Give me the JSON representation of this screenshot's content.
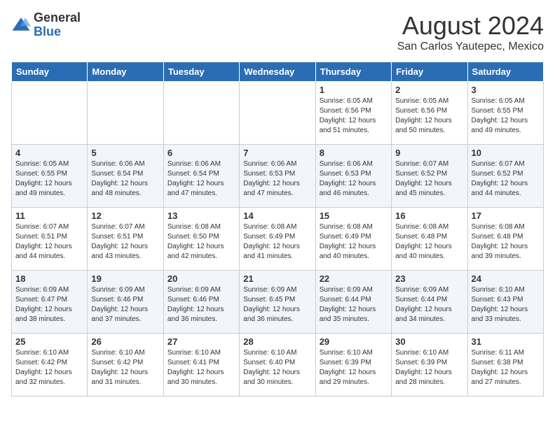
{
  "header": {
    "logo_general": "General",
    "logo_blue": "Blue",
    "month_title": "August 2024",
    "location": "San Carlos Yautepec, Mexico"
  },
  "weekdays": [
    "Sunday",
    "Monday",
    "Tuesday",
    "Wednesday",
    "Thursday",
    "Friday",
    "Saturday"
  ],
  "weeks": [
    [
      {
        "day": "",
        "info": ""
      },
      {
        "day": "",
        "info": ""
      },
      {
        "day": "",
        "info": ""
      },
      {
        "day": "",
        "info": ""
      },
      {
        "day": "1",
        "info": "Sunrise: 6:05 AM\nSunset: 6:56 PM\nDaylight: 12 hours\nand 51 minutes."
      },
      {
        "day": "2",
        "info": "Sunrise: 6:05 AM\nSunset: 6:56 PM\nDaylight: 12 hours\nand 50 minutes."
      },
      {
        "day": "3",
        "info": "Sunrise: 6:05 AM\nSunset: 6:55 PM\nDaylight: 12 hours\nand 49 minutes."
      }
    ],
    [
      {
        "day": "4",
        "info": "Sunrise: 6:05 AM\nSunset: 6:55 PM\nDaylight: 12 hours\nand 49 minutes."
      },
      {
        "day": "5",
        "info": "Sunrise: 6:06 AM\nSunset: 6:54 PM\nDaylight: 12 hours\nand 48 minutes."
      },
      {
        "day": "6",
        "info": "Sunrise: 6:06 AM\nSunset: 6:54 PM\nDaylight: 12 hours\nand 47 minutes."
      },
      {
        "day": "7",
        "info": "Sunrise: 6:06 AM\nSunset: 6:53 PM\nDaylight: 12 hours\nand 47 minutes."
      },
      {
        "day": "8",
        "info": "Sunrise: 6:06 AM\nSunset: 6:53 PM\nDaylight: 12 hours\nand 46 minutes."
      },
      {
        "day": "9",
        "info": "Sunrise: 6:07 AM\nSunset: 6:52 PM\nDaylight: 12 hours\nand 45 minutes."
      },
      {
        "day": "10",
        "info": "Sunrise: 6:07 AM\nSunset: 6:52 PM\nDaylight: 12 hours\nand 44 minutes."
      }
    ],
    [
      {
        "day": "11",
        "info": "Sunrise: 6:07 AM\nSunset: 6:51 PM\nDaylight: 12 hours\nand 44 minutes."
      },
      {
        "day": "12",
        "info": "Sunrise: 6:07 AM\nSunset: 6:51 PM\nDaylight: 12 hours\nand 43 minutes."
      },
      {
        "day": "13",
        "info": "Sunrise: 6:08 AM\nSunset: 6:50 PM\nDaylight: 12 hours\nand 42 minutes."
      },
      {
        "day": "14",
        "info": "Sunrise: 6:08 AM\nSunset: 6:49 PM\nDaylight: 12 hours\nand 41 minutes."
      },
      {
        "day": "15",
        "info": "Sunrise: 6:08 AM\nSunset: 6:49 PM\nDaylight: 12 hours\nand 40 minutes."
      },
      {
        "day": "16",
        "info": "Sunrise: 6:08 AM\nSunset: 6:48 PM\nDaylight: 12 hours\nand 40 minutes."
      },
      {
        "day": "17",
        "info": "Sunrise: 6:08 AM\nSunset: 6:48 PM\nDaylight: 12 hours\nand 39 minutes."
      }
    ],
    [
      {
        "day": "18",
        "info": "Sunrise: 6:09 AM\nSunset: 6:47 PM\nDaylight: 12 hours\nand 38 minutes."
      },
      {
        "day": "19",
        "info": "Sunrise: 6:09 AM\nSunset: 6:46 PM\nDaylight: 12 hours\nand 37 minutes."
      },
      {
        "day": "20",
        "info": "Sunrise: 6:09 AM\nSunset: 6:46 PM\nDaylight: 12 hours\nand 36 minutes."
      },
      {
        "day": "21",
        "info": "Sunrise: 6:09 AM\nSunset: 6:45 PM\nDaylight: 12 hours\nand 36 minutes."
      },
      {
        "day": "22",
        "info": "Sunrise: 6:09 AM\nSunset: 6:44 PM\nDaylight: 12 hours\nand 35 minutes."
      },
      {
        "day": "23",
        "info": "Sunrise: 6:09 AM\nSunset: 6:44 PM\nDaylight: 12 hours\nand 34 minutes."
      },
      {
        "day": "24",
        "info": "Sunrise: 6:10 AM\nSunset: 6:43 PM\nDaylight: 12 hours\nand 33 minutes."
      }
    ],
    [
      {
        "day": "25",
        "info": "Sunrise: 6:10 AM\nSunset: 6:42 PM\nDaylight: 12 hours\nand 32 minutes."
      },
      {
        "day": "26",
        "info": "Sunrise: 6:10 AM\nSunset: 6:42 PM\nDaylight: 12 hours\nand 31 minutes."
      },
      {
        "day": "27",
        "info": "Sunrise: 6:10 AM\nSunset: 6:41 PM\nDaylight: 12 hours\nand 30 minutes."
      },
      {
        "day": "28",
        "info": "Sunrise: 6:10 AM\nSunset: 6:40 PM\nDaylight: 12 hours\nand 30 minutes."
      },
      {
        "day": "29",
        "info": "Sunrise: 6:10 AM\nSunset: 6:39 PM\nDaylight: 12 hours\nand 29 minutes."
      },
      {
        "day": "30",
        "info": "Sunrise: 6:10 AM\nSunset: 6:39 PM\nDaylight: 12 hours\nand 28 minutes."
      },
      {
        "day": "31",
        "info": "Sunrise: 6:11 AM\nSunset: 6:38 PM\nDaylight: 12 hours\nand 27 minutes."
      }
    ]
  ]
}
